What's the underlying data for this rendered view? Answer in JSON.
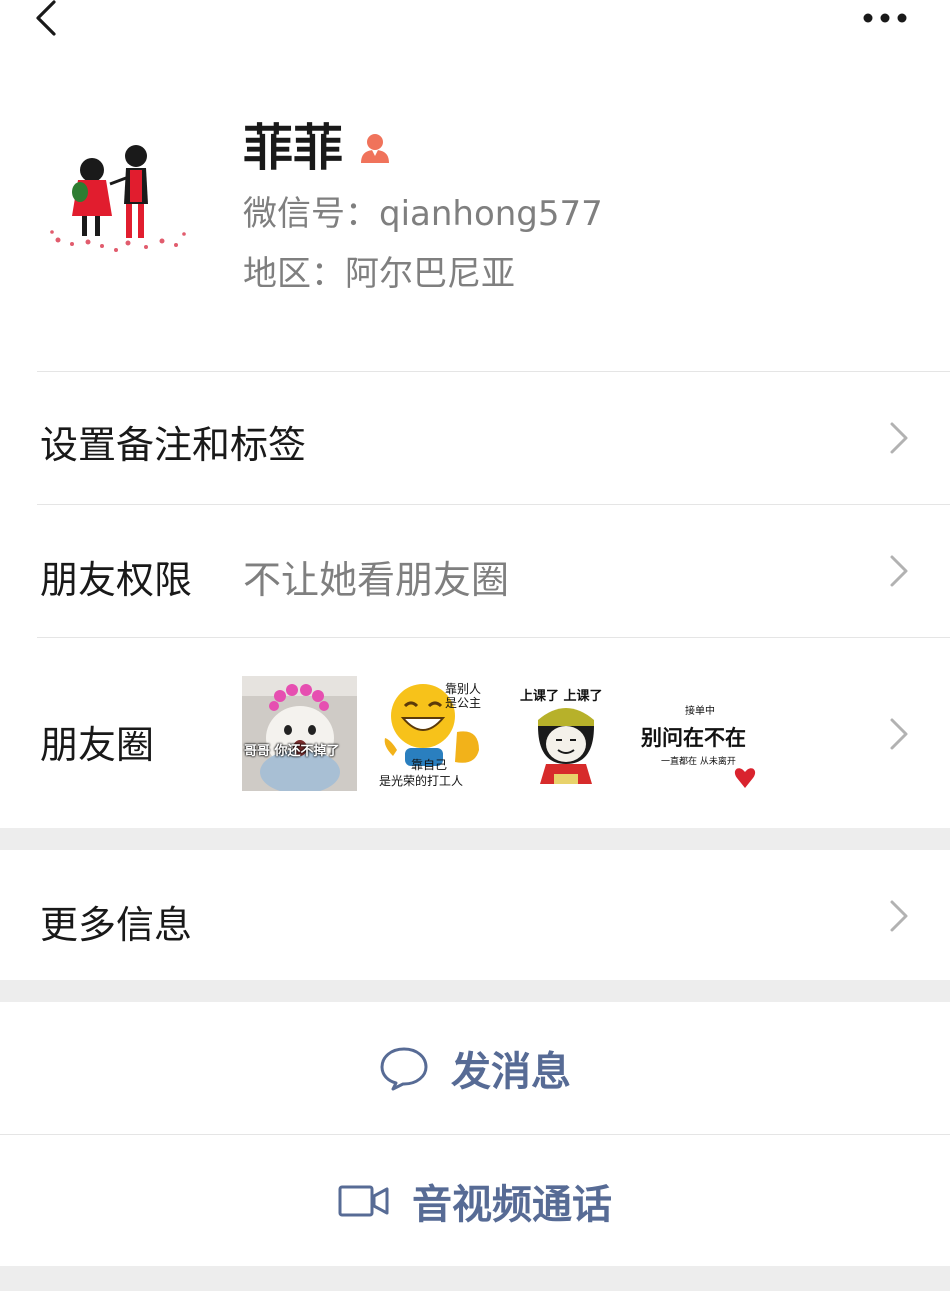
{
  "profile": {
    "name": "菲菲",
    "wechat_id_line": "微信号：qianhong577",
    "region_line": "地区：阿尔巴尼亚"
  },
  "rows": {
    "remark": {
      "label": "设置备注和标签"
    },
    "permission": {
      "label": "朋友权限",
      "value": "不让她看朋友圈"
    },
    "moments": {
      "label": "朋友圈",
      "thumbs": [
        {
          "caption": "哥哥 你还不掉了"
        },
        {
          "caption_top": "靠别人\n是公主",
          "caption_mid": "靠自己",
          "caption_bottom": "是光荣的打工人"
        },
        {
          "caption": "上课了 上课了"
        },
        {
          "caption_top": "接单中",
          "caption_mid": "别问在不在",
          "caption_bottom": "一直都在 从未离开"
        }
      ]
    },
    "more_info": {
      "label": "更多信息"
    }
  },
  "actions": {
    "message": "发消息",
    "call": "音视频通话"
  },
  "colors": {
    "link_blue": "#576b95",
    "gender_icon": "#f0735b",
    "text_primary": "#191919",
    "text_secondary": "#7f7f7f",
    "separator": "#ededed"
  },
  "icons": [
    "back-icon",
    "more-icon",
    "female-icon",
    "chevron-right-icon",
    "chat-bubble-icon",
    "video-camera-icon"
  ]
}
